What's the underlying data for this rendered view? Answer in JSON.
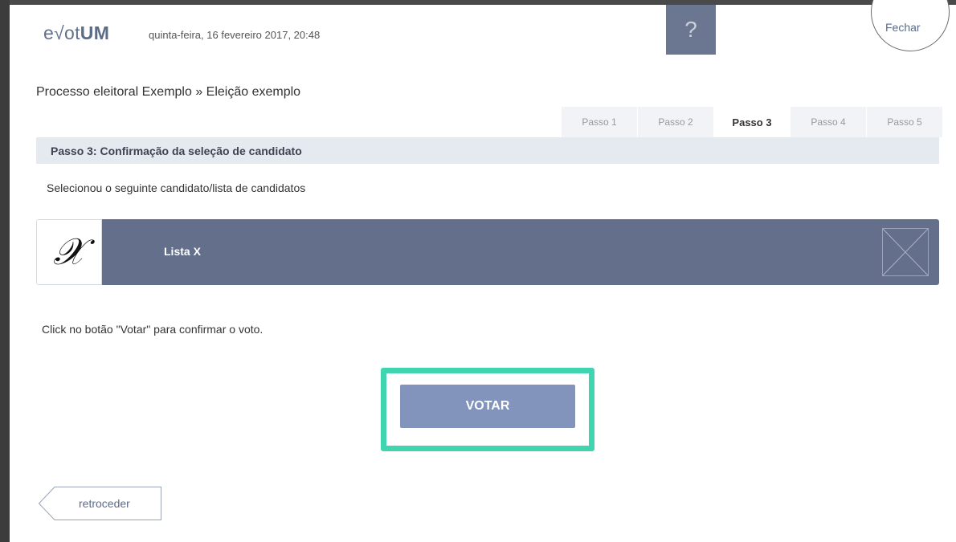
{
  "header": {
    "logo_prefix": "e√ot",
    "logo_bold": "UM",
    "datetime": "quinta-feira, 16 fevereiro 2017, 20:48",
    "help_label": "?",
    "close_label": "Fechar"
  },
  "breadcrumb": "Processo eleitoral Exemplo » Eleição exemplo",
  "steps": [
    {
      "label": "Passo 1",
      "active": false
    },
    {
      "label": "Passo 2",
      "active": false
    },
    {
      "label": "Passo 3",
      "active": true
    },
    {
      "label": "Passo 4",
      "active": false
    },
    {
      "label": "Passo 5",
      "active": false
    }
  ],
  "step_header": "Passo 3: Confirmação da seleção de candidato",
  "selected_message": "Selecionou o seguinte candidato/lista de candidatos",
  "candidate": {
    "logo_glyph": "𝒳",
    "name": "Lista X"
  },
  "click_message": "Click no botão \"Votar\" para confirmar o voto.",
  "votar_label": "VOTAR",
  "back_label": "retroceder",
  "colors": {
    "accent_bar": "#636f8b",
    "votar_button": "#8294bb",
    "highlight_outline": "#3fd5b0",
    "step_header_bg": "#e5e9f0"
  },
  "icons": {
    "help": "question-mark-icon",
    "remove": "close-x-icon",
    "back": "back-arrow-shape"
  }
}
